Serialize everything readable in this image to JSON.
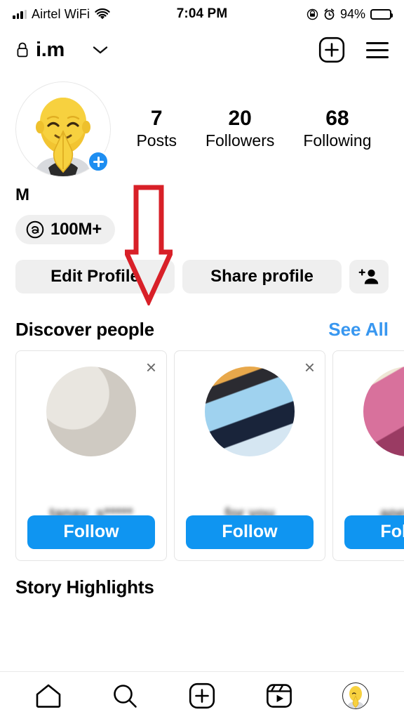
{
  "status_bar": {
    "carrier": "Airtel WiFi",
    "time": "7:04 PM",
    "battery_percent": "94%",
    "icons": [
      "signal-bars-icon",
      "wifi-icon",
      "rotation-lock-icon",
      "alarm-icon",
      "battery-icon"
    ]
  },
  "header": {
    "lock_icon": "lock-icon",
    "username": "i.m",
    "chevron_icon": "chevron-down-icon",
    "create_icon": "plus-square-icon",
    "menu_icon": "hamburger-menu-icon"
  },
  "profile": {
    "avatar_alt": "praying-memoji-avatar",
    "add_story_label": "+",
    "stats": [
      {
        "number": "7",
        "label": "Posts"
      },
      {
        "number": "20",
        "label": "Followers"
      },
      {
        "number": "68",
        "label": "Following"
      }
    ],
    "display_name": "M",
    "threads_badge": {
      "icon": "threads-logo-icon",
      "label": "100M+"
    }
  },
  "actions": {
    "edit_profile": "Edit Profile",
    "share_profile": "Share profile",
    "add_person_icon": "add-person-icon"
  },
  "discover": {
    "title": "Discover people",
    "see_all": "See All",
    "cards": [
      {
        "username": "tanay_s*****",
        "follow_label": "Follow",
        "close_label": "×"
      },
      {
        "username": "for you",
        "follow_label": "Follow",
        "close_label": "×"
      },
      {
        "username": "apex****",
        "follow_label": "Follow",
        "close_label": "×"
      }
    ]
  },
  "highlights": {
    "title": "Story Highlights"
  },
  "bottom_nav": {
    "items": [
      {
        "icon": "home-icon",
        "name": "nav-home"
      },
      {
        "icon": "search-icon",
        "name": "nav-search"
      },
      {
        "icon": "create-icon",
        "name": "nav-create"
      },
      {
        "icon": "reels-icon",
        "name": "nav-reels"
      },
      {
        "icon": "profile-avatar-icon",
        "name": "nav-profile"
      }
    ]
  },
  "annotation": {
    "type": "down-arrow",
    "color": "#D82028",
    "points_to": "Edit Profile"
  },
  "colors": {
    "accent_blue": "#0f95f1",
    "link_blue": "#3897f0",
    "chip_gray": "#efefef",
    "annotation_red": "#D82028"
  }
}
